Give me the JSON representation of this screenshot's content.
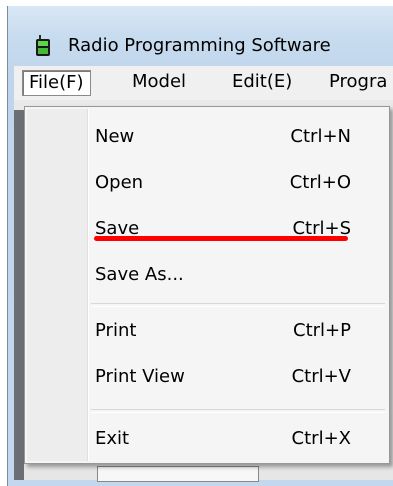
{
  "window": {
    "title": "Radio Programming Software",
    "icon": "radio-icon"
  },
  "menubar": {
    "items": [
      {
        "label": "File(F)",
        "active": true
      },
      {
        "label": "Model"
      },
      {
        "label": "Edit(E)"
      },
      {
        "label": "Progra"
      }
    ]
  },
  "file_menu": {
    "items": [
      {
        "label": "New",
        "shortcut": "Ctrl+N"
      },
      {
        "label": "Open",
        "shortcut": "Ctrl+O"
      },
      {
        "label": "Save",
        "shortcut": "Ctrl+S",
        "highlighted": true
      },
      {
        "label": "Save As...",
        "shortcut": ""
      },
      {
        "label": "Print",
        "shortcut": "Ctrl+P"
      },
      {
        "label": "Print View",
        "shortcut": "Ctrl+V"
      },
      {
        "label": "Exit",
        "shortcut": "Ctrl+X"
      }
    ]
  },
  "colors": {
    "annotation": "#ff0000"
  }
}
